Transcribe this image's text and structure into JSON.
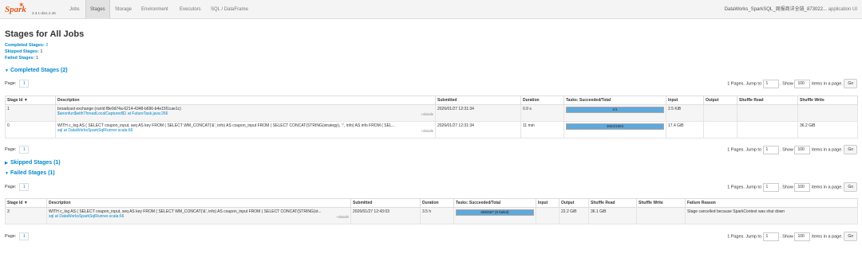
{
  "nav": {
    "brand": "Spark",
    "version": "3.3.1-dw1.2.46",
    "tabs": [
      "Jobs",
      "Stages",
      "Storage",
      "Environment",
      "Executors",
      "SQL / DataFrame"
    ],
    "app_name": "DataWorks_SparkSQL_周报商详全链_873022...",
    "app_suffix": "application UI"
  },
  "page_title": "Stages for All Jobs",
  "summary": {
    "completed_label": "Completed Stages:",
    "completed_count": "2",
    "skipped_label": "Skipped Stages:",
    "skipped_count": "1",
    "failed_label": "Failed Stages:",
    "failed_count": "1"
  },
  "sections": {
    "completed": "Completed Stages (2)",
    "skipped": "Skipped Stages (1)",
    "failed": "Failed Stages (1)"
  },
  "pager": {
    "page_label": "Page:",
    "page_value": "1",
    "pages_text": "1 Pages. Jump to",
    "jump_value": "1",
    "show_label": ". Show",
    "show_value": "100",
    "items_label": "items in a page.",
    "go_label": "Go"
  },
  "completed_table": {
    "headers": [
      "Stage Id ▼",
      "Description",
      "Submitted",
      "Duration",
      "Tasks: Succeeded/Total",
      "Input",
      "Output",
      "Shuffle Read",
      "Shuffle Write"
    ],
    "rows": [
      {
        "id": "1",
        "desc1": "broadcast exchange (runId f8e0d74a-6214-4348-b696-b4e15f1cae1c)",
        "desc2": "$anonfun$withThreadLocalCaptured$1 at FutureTask.java:266",
        "details": "+details",
        "submitted": "2026/01/27 12:31:34",
        "duration": "0.9 s",
        "tasks": "1/1",
        "progress": 1.0,
        "input": "2.5 KiB",
        "output": "",
        "shuffle_read": "",
        "shuffle_write": ""
      },
      {
        "id": "0",
        "desc1": "WITH c_log AS ( SELECT coupon_input, seq AS key FROM ( SELECT WM_CONCAT('&', info) AS coupon_input FROM ( SELECT CONCAT(STRING(strategy), ':', info) AS info FROM ( SEL...",
        "desc2": "sql at DataWorksSparkSqlRunner.scala:66",
        "details": "+details",
        "submitted": "2026/01/27 12:31:34",
        "duration": "11 min",
        "tasks": "1504/1504",
        "progress": 1.0,
        "input": "17.4 GiB",
        "output": "",
        "shuffle_read": "",
        "shuffle_write": "36.2 GiB"
      }
    ]
  },
  "failed_table": {
    "headers": [
      "Stage Id ▼",
      "Description",
      "Submitted",
      "Duration",
      "Tasks: Succeeded/Total",
      "Input",
      "Output",
      "Shuffle Read",
      "Shuffle Write",
      "Failure Reason"
    ],
    "rows": [
      {
        "id": "3",
        "desc1": "WITH c_log AS ( SELECT coupon_input, seq AS key FROM ( SELECT WM_CONCAT('&', info) AS coupon_input FROM ( SELECT CONCAT(STRING(st...",
        "desc2": "sql at DataWorksSparkSqlRunner.scala:66",
        "details": "+details",
        "submitted": "2026/01/27 12:43:03",
        "duration": "3.5 h",
        "tasks": "685/667 (8 failed)",
        "progress": 1.0,
        "input": "",
        "output": "22.2 GiB",
        "shuffle_read": "36.1 GiB",
        "shuffle_write": "",
        "failure_reason": "Stage cancelled because SparkContext was shut down"
      }
    ]
  },
  "colors": {
    "link": "#0088cc",
    "brand": "#e25a1c",
    "progress": "#5fa8dc"
  }
}
